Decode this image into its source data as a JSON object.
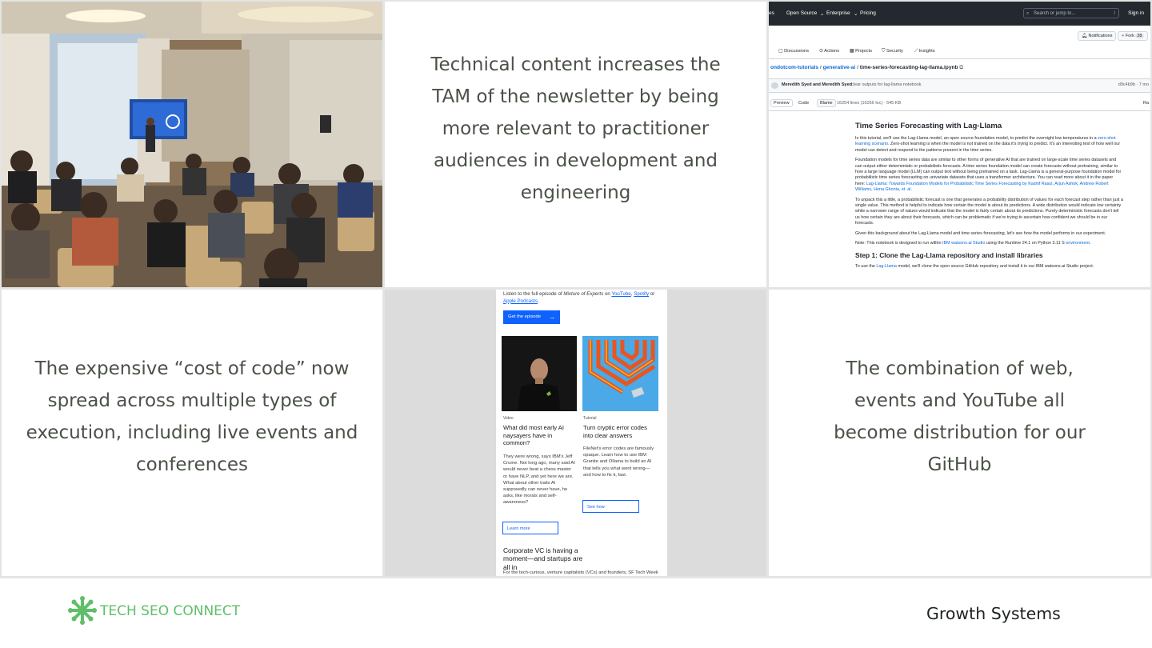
{
  "slide": {
    "quote_tam": "Technical content increases the TAM of the newsletter by being more relevant to practitioner audiences in development and engineering",
    "quote_cost": "The expensive “cost of code” now spread across multiple types of execution, including live events and conferences",
    "quote_distribution": "The combination of web, events and YouTube all become distribution for our GitHub"
  },
  "github": {
    "nav": [
      "es",
      "Open Source",
      "Enterprise",
      "Pricing"
    ],
    "search_placeholder": "Search or jump to...",
    "search_key": "/",
    "sign_in": "Sign in",
    "notifications": "Notifications",
    "fork": "Fork",
    "fork_count": "28",
    "tabs": [
      "Discussions",
      "Actions",
      "Projects",
      "Security",
      "Insights"
    ],
    "path_repo": "ondotcom-tutorials",
    "path_dir": "generative-ai",
    "path_file": "time-series-forecasting-lag-llama.ipynb",
    "commit_authors": "Meredith Syed and Meredith Syed",
    "commit_message": "clear outputs for lag-llama notebook",
    "commit_hash": "d9c4b9b · 7 mo",
    "view_tabs": [
      "Preview",
      "Code",
      "Blame"
    ],
    "file_stats": "16254 lines (16256 loc) · 545 KB",
    "raw": "Ra",
    "nb_title": "Time Series Forecasting with Lag-Llama",
    "nb_p1_a": "In this tutorial, we'll use the Lag-Llama model, an open source foundation model, to predict the overnight low temperatures in a ",
    "nb_p1_link": "zero-shot learning scenario",
    "nb_p1_b": ". Zero-shot learning is when the model is not trained on the data it's trying to predict. It's an interesting test of how well our model can detect and respond to the patterns present in the time series.",
    "nb_p2_a": "Foundation models for time series data are similar to other forms of generative AI that are trained on large-scale time series datasets and can output either deterministic or probabilistic forecasts. A time series foundation model can create forecasts without pretraining, similar to how a large language model (LLM) can output text without being pretrained on a task. Lag-Llama is a general-purpose foundation model for probabilistic time series forecasting on univariate datasets that uses a transformer architecture. You can read more about it in the paper here: ",
    "nb_p2_link": "Lag-Llama: Towards Foundation Models for Probabilistic Time Series Forecasting by Kashif Rasul, Arjun Ashok, Andrew Robert Williams, Hena Ghonia, et. al.",
    "nb_p3": "To unpack this a little, a probabilistic forecast is one that generates a probability distribution of values for each forecast step rather than just a single value. This method is helpful to indicate how certain the model is about its predictions. A wide distribution would indicate low certainty while a narrower range of values would indicate that the model is fairly certain about its predictions. Purely deterministic forecasts don't tell us how certain they are about their forecasts, which can be problematic if we're trying to ascertain how confident we should be in our forecasts.",
    "nb_p4": "Given this background about the Lag-Llama model and time series forecasting, let's see how the model performs in our experiment.",
    "nb_p5_a": "Note: This notebook is designed to run within ",
    "nb_p5_link1": "IBM watsonx.ai Studio",
    "nb_p5_b": " using the Runtime 24.1 on Python 3.11 S ",
    "nb_p5_link2": "environment",
    "nb_p5_c": ".",
    "nb_step1": "Step 1: Clone the Lag-Llama repository and install libraries",
    "nb_p6_a": "To use the ",
    "nb_p6_link": "Lag-Llama",
    "nb_p6_b": " model, we'll clone the open source GitHub repository and install it in our IBM watsonx.ai Studio project."
  },
  "newsletter": {
    "intro_a": "Listen to the full episode of ",
    "intro_show": "Mixture of Experts",
    "intro_b": " on ",
    "intro_yt": "YouTube",
    "intro_c": ", ",
    "intro_spotify": "Spotify",
    "intro_d": " or ",
    "intro_apple": "Apple Podcasts",
    "intro_e": ".",
    "cta": "Get the episode",
    "cta_arrow": "→",
    "left_kicker": "Video",
    "left_head": "What did most early AI naysayers have in common?",
    "left_body": "They were wrong, says IBM's Jeff Crume. Not long ago, many said AI would never beat a chess master or have NLP, and yet here we are. What about other traits AI supposedly can never have, he asks, like morals and self-awareness?",
    "left_btn": "Learn more",
    "right_kicker": "Tutorial",
    "right_head": "Turn cryptic error codes into clear answers",
    "right_body": "FileNet's error codes are famously opaque. Learn how to use IBM Granite and Ollama to build an AI that tells you what went wrong—and how to fix it, fast.",
    "right_btn": "See how",
    "bottom_head": "Corporate VC is having a moment—and startups are all in",
    "bottom_body": "For the tech-curious, venture capitalists (VCs) and founders, SF Tech Week"
  },
  "footer": {
    "brand": "TECH SEO CONNECT",
    "tagline": "Growth Systems"
  },
  "colors": {
    "brand_green": "#5fbf68",
    "text_gray": "#4a5248",
    "link_blue": "#0969da",
    "ibm_blue": "#0f62fe"
  }
}
